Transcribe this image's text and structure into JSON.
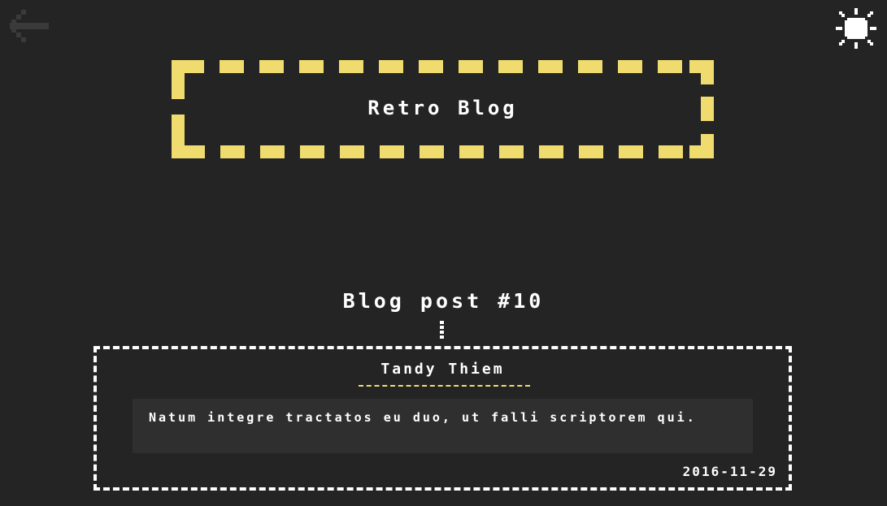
{
  "header": {
    "back_icon": "arrow-left-icon",
    "theme_icon": "sun-icon",
    "site_title": "Retro Blog"
  },
  "post": {
    "heading": "Blog post #10",
    "author": "Tandy Thiem",
    "content": "Natum integre tractatos eu duo, ut falli scriptorem qui.",
    "date": "2016-11-29"
  },
  "colors": {
    "background": "#242424",
    "accent": "#f0dc6e",
    "text": "#ffffff",
    "content_bg": "#2f2f2f",
    "muted_icon": "#3a3a3a"
  }
}
